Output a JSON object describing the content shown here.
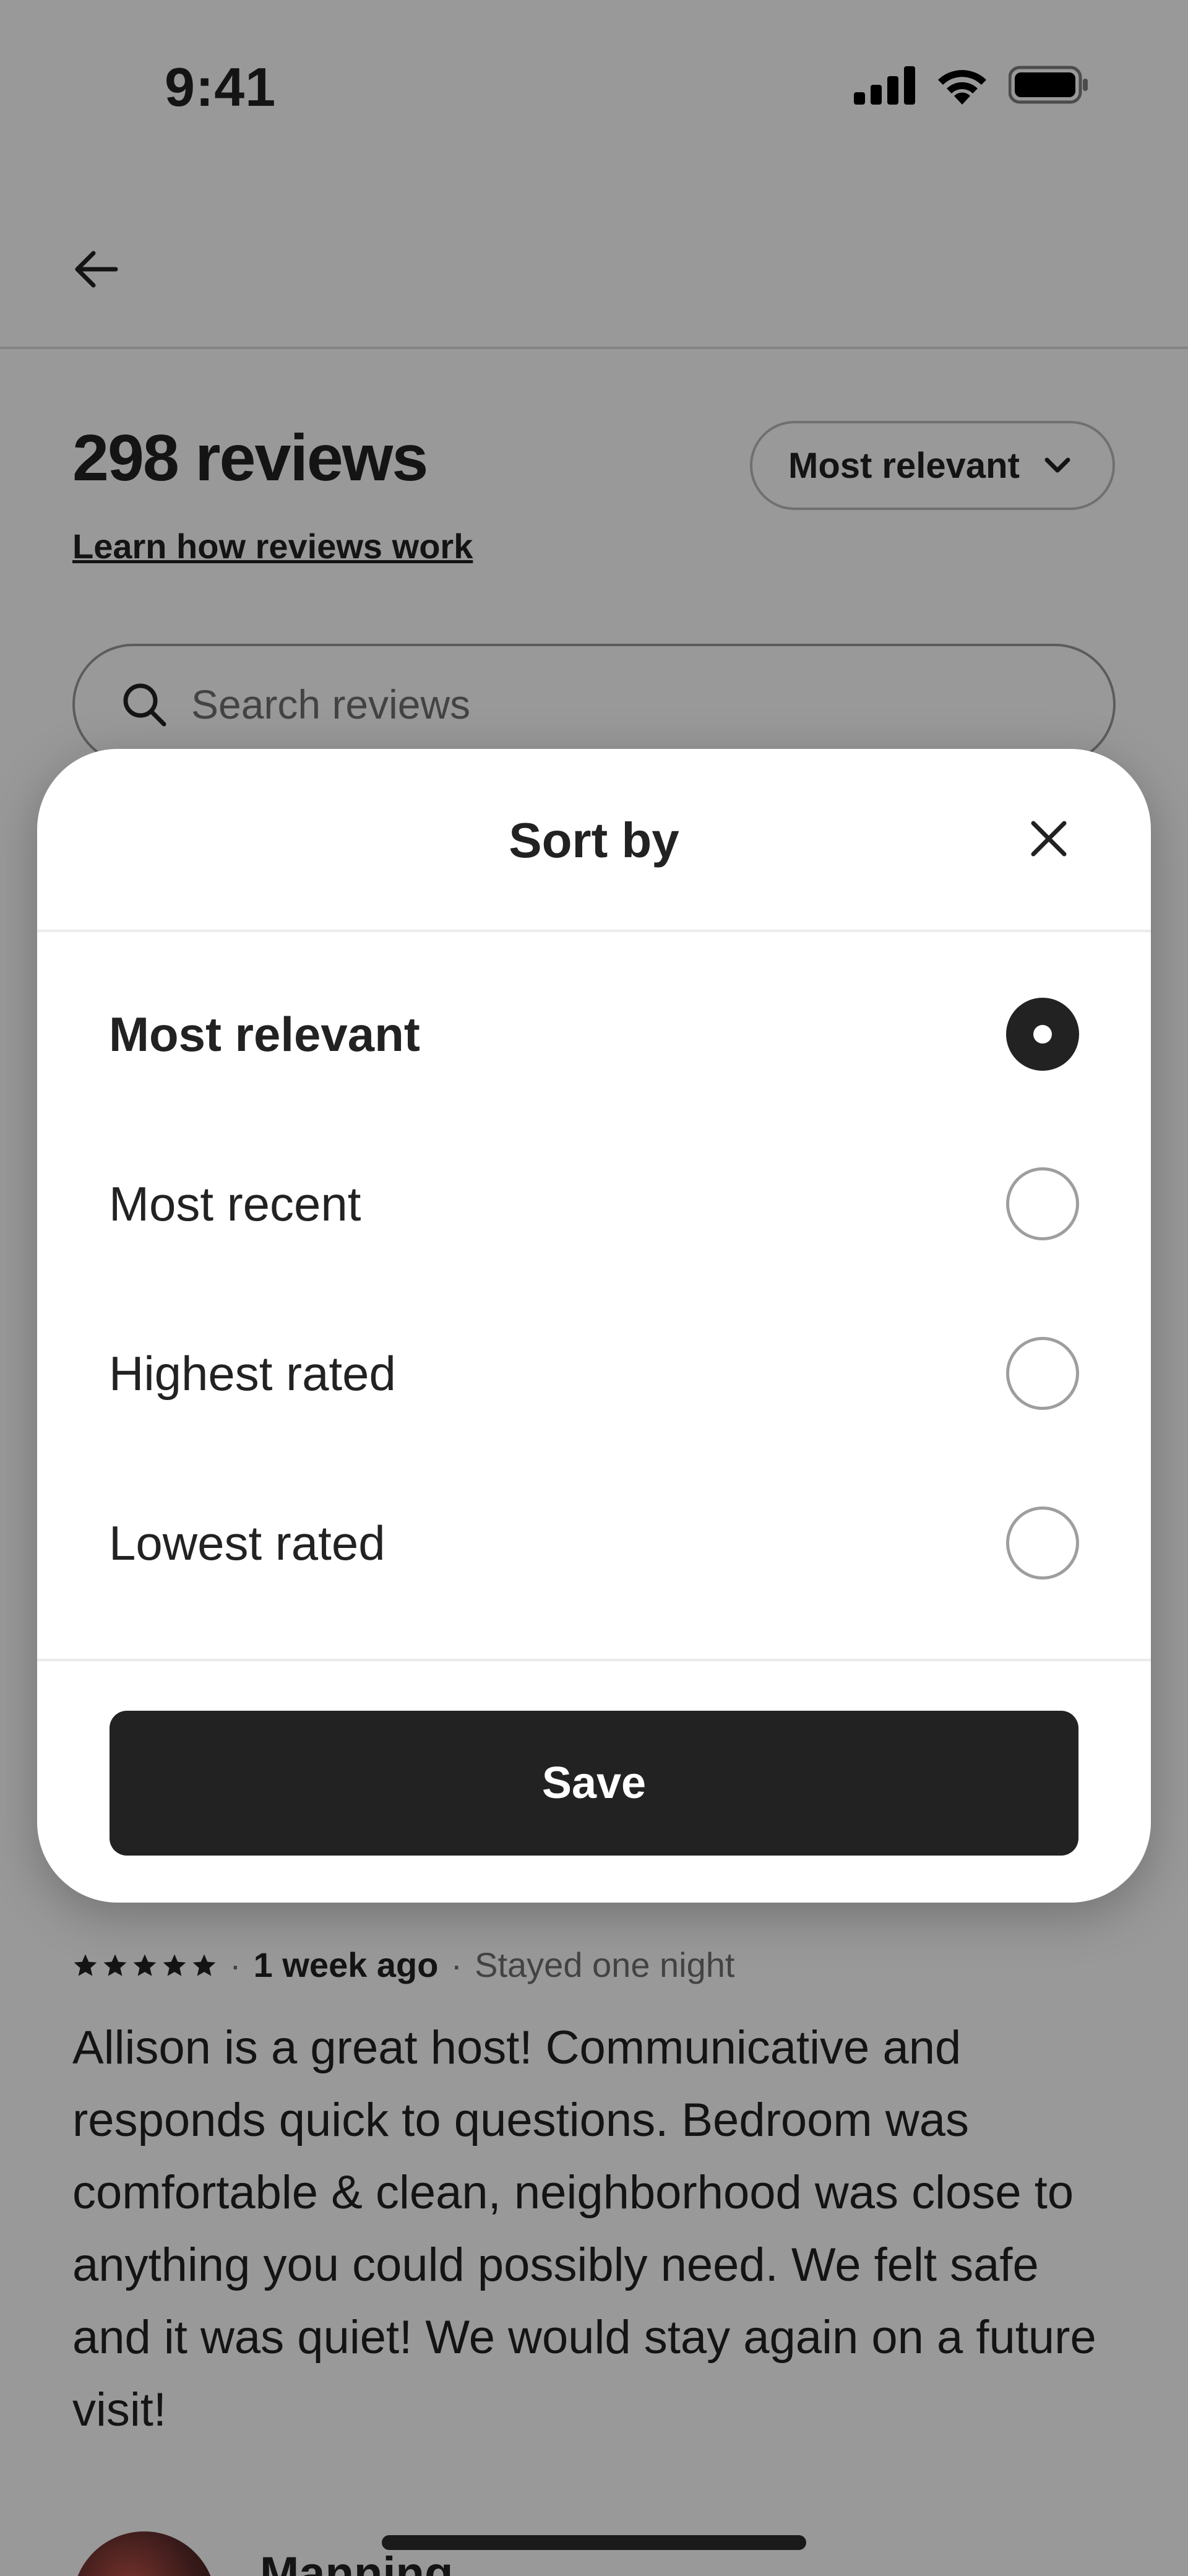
{
  "status_bar": {
    "time": "9:41"
  },
  "page": {
    "reviews_count_title": "298 reviews",
    "learn_link": "Learn how reviews work",
    "sort_pill_label": "Most relevant",
    "search_placeholder": "Search reviews"
  },
  "review": {
    "rating_stars": 5,
    "when": "1 week ago",
    "separator": "·",
    "stay": "Stayed one night",
    "body": "Allison is a great host! Communicative and responds quick to questions. Bedroom was comfortable & clean, neighborhood was close to anything you could possibly need. We felt safe and it was quiet! We would stay again on a future visit!",
    "author_name": "Manning"
  },
  "sort_sheet": {
    "title": "Sort by",
    "options": [
      {
        "label": "Most relevant",
        "selected": true
      },
      {
        "label": "Most recent",
        "selected": false
      },
      {
        "label": "Highest rated",
        "selected": false
      },
      {
        "label": "Lowest rated",
        "selected": false
      }
    ],
    "save_label": "Save"
  },
  "colors": {
    "text_primary": "#222222",
    "text_secondary": "#717171",
    "scrim": "rgba(0,0,0,0.40)",
    "button_bg": "#222222"
  }
}
